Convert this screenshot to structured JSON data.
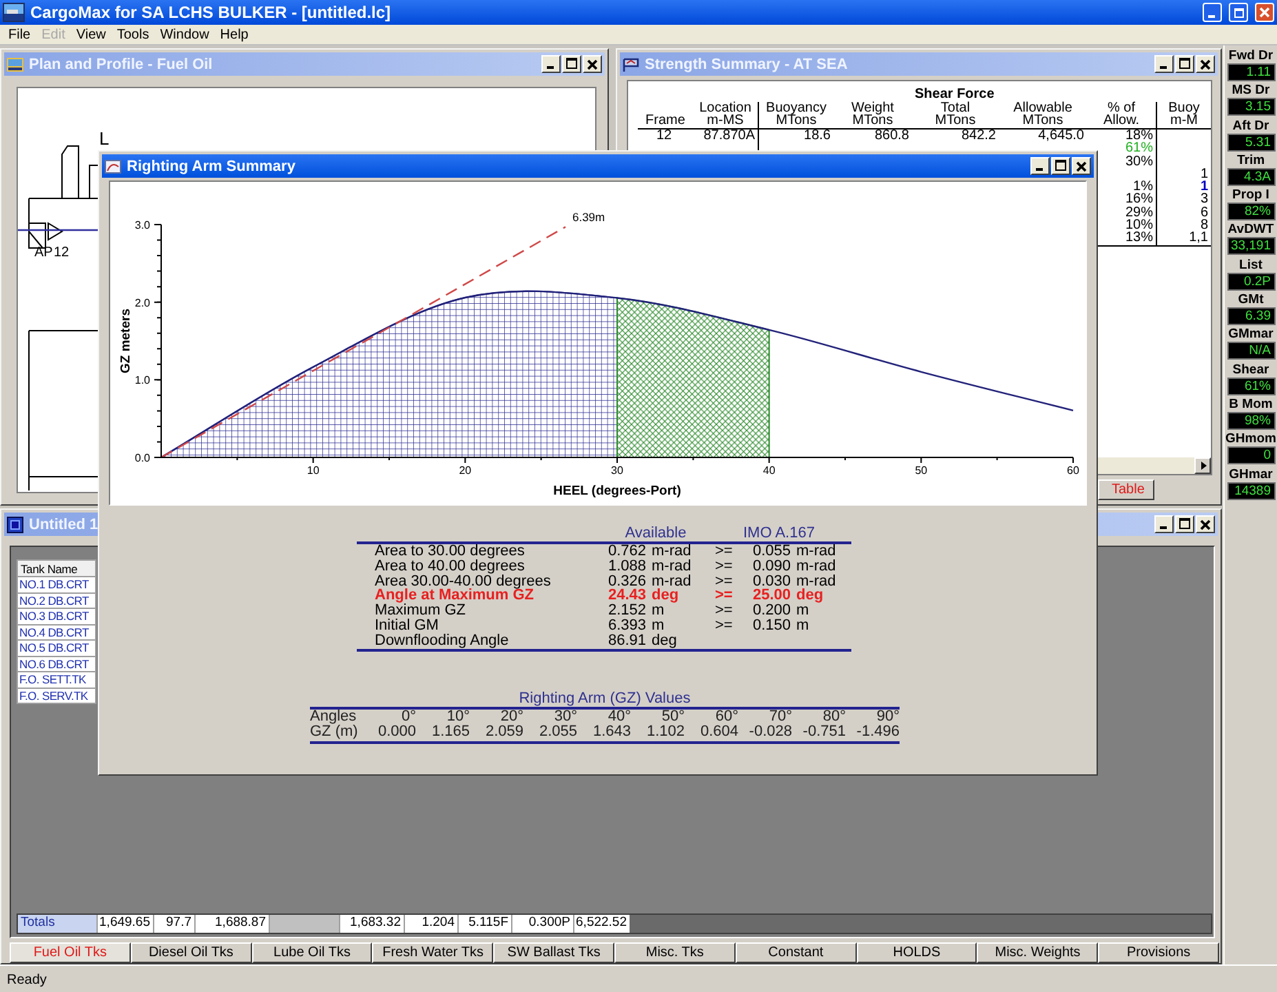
{
  "app": {
    "title": "CargoMax for SA LCHS BULKER - [untitled.lc]"
  },
  "menu": [
    {
      "label": "File",
      "disabled": false
    },
    {
      "label": "Edit",
      "disabled": true
    },
    {
      "label": "View",
      "disabled": false
    },
    {
      "label": "Tools",
      "disabled": false
    },
    {
      "label": "Window",
      "disabled": false
    },
    {
      "label": "Help",
      "disabled": false
    }
  ],
  "plan_window": {
    "title": "Plan and Profile - Fuel Oil",
    "active": false,
    "labels": [
      "L",
      "AP",
      "12"
    ]
  },
  "strength_window": {
    "title": "Strength Summary - AT SEA",
    "active": false,
    "group_header": "Shear Force",
    "columns": [
      "Frame",
      "Location\nm-MS",
      "Buoyancy\nMTons",
      "Weight\nMTons",
      "Total\nMTons",
      "Allowable\nMTons",
      "% of\nAllow.",
      "Buoy\nm-M"
    ],
    "rows": [
      {
        "frame": "12",
        "location": "87.870A",
        "buoyancy": "18.6",
        "weight": "860.8",
        "total": "842.2",
        "allowable": "4,645.0",
        "pct": "18%",
        "max": false,
        "current": false
      },
      {
        "pct": "61%",
        "max": true,
        "current": false
      },
      {
        "pct": "30%",
        "max": false,
        "current": false
      },
      {
        "buoy": "1",
        "max": false,
        "current": false
      },
      {
        "pct": "1%",
        "buoy": "1",
        "max": false,
        "current": true
      },
      {
        "pct": "16%",
        "buoy": "3",
        "max": false,
        "current": false
      },
      {
        "pct": "29%",
        "buoy": "6",
        "max": false,
        "current": false
      },
      {
        "pct": "10%",
        "buoy": "8",
        "max": false,
        "current": false
      },
      {
        "pct": "13%",
        "buoy": "1,1",
        "max": false,
        "current": false
      }
    ],
    "tabs": [
      {
        "label": "Table",
        "selected": true
      }
    ]
  },
  "tank_window": {
    "title": "Untitled 1",
    "active": false,
    "header": "Tank Name",
    "tanks": [
      "NO.1 DB.CRT",
      "NO.2 DB.CRT",
      "NO.3 DB.CRT",
      "NO.4 DB.CRT",
      "NO.5 DB.CRT",
      "NO.6 DB.CRT",
      "F.O. SETT.TK",
      "F.O. SERV.TK"
    ],
    "totals_label": "Totals",
    "totals": [
      "1,649.65",
      "97.7",
      "1,688.87",
      "1,683.32",
      "1.204",
      "5.115F",
      "0.300P",
      "6,522.52"
    ],
    "tabs": [
      {
        "label": "Fuel Oil Tks",
        "selected": true
      },
      {
        "label": "Diesel Oil Tks",
        "selected": false
      },
      {
        "label": "Lube Oil Tks",
        "selected": false
      },
      {
        "label": "Fresh Water Tks",
        "selected": false
      },
      {
        "label": "SW Ballast Tks",
        "selected": false
      },
      {
        "label": "Misc. Tks",
        "selected": false
      },
      {
        "label": "Constant",
        "selected": false
      },
      {
        "label": "HOLDS",
        "selected": false
      },
      {
        "label": "Misc. Weights",
        "selected": false
      },
      {
        "label": "Provisions",
        "selected": false
      }
    ]
  },
  "righting_window": {
    "title": "Righting Arm Summary",
    "active": true,
    "chart_data": {
      "type": "area",
      "xlabel": "HEEL (degrees-Port)",
      "ylabel": "GZ meters",
      "x": [
        0,
        10,
        20,
        30,
        40,
        50,
        60
      ],
      "series": [
        {
          "type": "area",
          "color": "#23238f",
          "values": [
            0,
            1.165,
            2.059,
            2.055,
            null,
            null,
            null
          ]
        },
        {
          "type": "area",
          "color": "#2e8b2e",
          "values": [
            null,
            null,
            null,
            2.055,
            1.643,
            null,
            null
          ]
        },
        {
          "type": "line",
          "color": "#22227a",
          "values": [
            0,
            1.165,
            2.059,
            2.055,
            1.643,
            1.102,
            0.604
          ]
        }
      ],
      "xlim": [
        0,
        60
      ],
      "ylim": [
        0,
        3
      ],
      "xticks": [
        10,
        20,
        30,
        40,
        50,
        60
      ],
      "yticks": [
        {
          "value": 0,
          "label": "0.0"
        },
        {
          "value": 1,
          "label": "1.0"
        },
        {
          "value": 2,
          "label": "2.0"
        },
        {
          "value": 3,
          "label": "3.0"
        }
      ],
      "annotations": [
        {
          "text": "6.39m"
        }
      ]
    },
    "criteria": {
      "headers": [
        "Available",
        "IMO A.167"
      ],
      "rows": [
        {
          "label": "Area to 30.00 degrees",
          "value": "0.762",
          "unit": "m-rad",
          "op": ">=",
          "required": "0.055",
          "required_unit": "m-rad",
          "failed": false
        },
        {
          "label": "Area to 40.00 degrees",
          "value": "1.088",
          "unit": "m-rad",
          "op": ">=",
          "required": "0.090",
          "required_unit": "m-rad",
          "failed": false
        },
        {
          "label": "Area 30.00-40.00 degrees",
          "value": "0.326",
          "unit": "m-rad",
          "op": ">=",
          "required": "0.030",
          "required_unit": "m-rad",
          "failed": false
        },
        {
          "label": "Angle at Maximum GZ",
          "value": "24.43",
          "unit": "deg",
          "op": ">=",
          "required": "25.00",
          "required_unit": "deg",
          "failed": true
        },
        {
          "label": "Maximum GZ",
          "value": "2.152",
          "unit": "m",
          "op": ">=",
          "required": "0.200",
          "required_unit": "m",
          "failed": false
        },
        {
          "label": "Initial GM",
          "value": "6.393",
          "unit": "m",
          "op": ">=",
          "required": "0.150",
          "required_unit": "m",
          "failed": false
        },
        {
          "label": "Downflooding Angle",
          "value": "86.91",
          "unit": "deg",
          "failed": false
        }
      ]
    },
    "gz_table": {
      "title": "Righting Arm (GZ) Values",
      "row_labels": [
        "Angles",
        "GZ (m)"
      ],
      "angles": [
        "0°",
        "10°",
        "20°",
        "30°",
        "40°",
        "50°",
        "60°",
        "70°",
        "80°",
        "90°"
      ],
      "gz": [
        "0.000",
        "1.165",
        "2.059",
        "2.055",
        "1.643",
        "1.102",
        "0.604",
        "-0.028",
        "-0.751",
        "-1.496"
      ]
    }
  },
  "readouts": [
    {
      "label": "Fwd Dr",
      "value": "1.11"
    },
    {
      "label": "MS Dr",
      "value": "3.15"
    },
    {
      "label": "Aft Dr",
      "value": "5.31"
    },
    {
      "label": "Trim",
      "value": "4.3A"
    },
    {
      "label": "Prop I",
      "value": "82%"
    },
    {
      "label": "AvDWT",
      "value": "33,191"
    },
    {
      "label": "List",
      "value": "0.2P"
    },
    {
      "label": "GMt",
      "value": "6.39"
    },
    {
      "label": "GMmar",
      "value": "N/A"
    },
    {
      "label": "Shear",
      "value": "61%"
    },
    {
      "label": "B Mom",
      "value": "98%"
    },
    {
      "label": "GHmom",
      "value": "0"
    },
    {
      "label": "GHmar",
      "value": "14389"
    }
  ],
  "status_bar": "Ready"
}
